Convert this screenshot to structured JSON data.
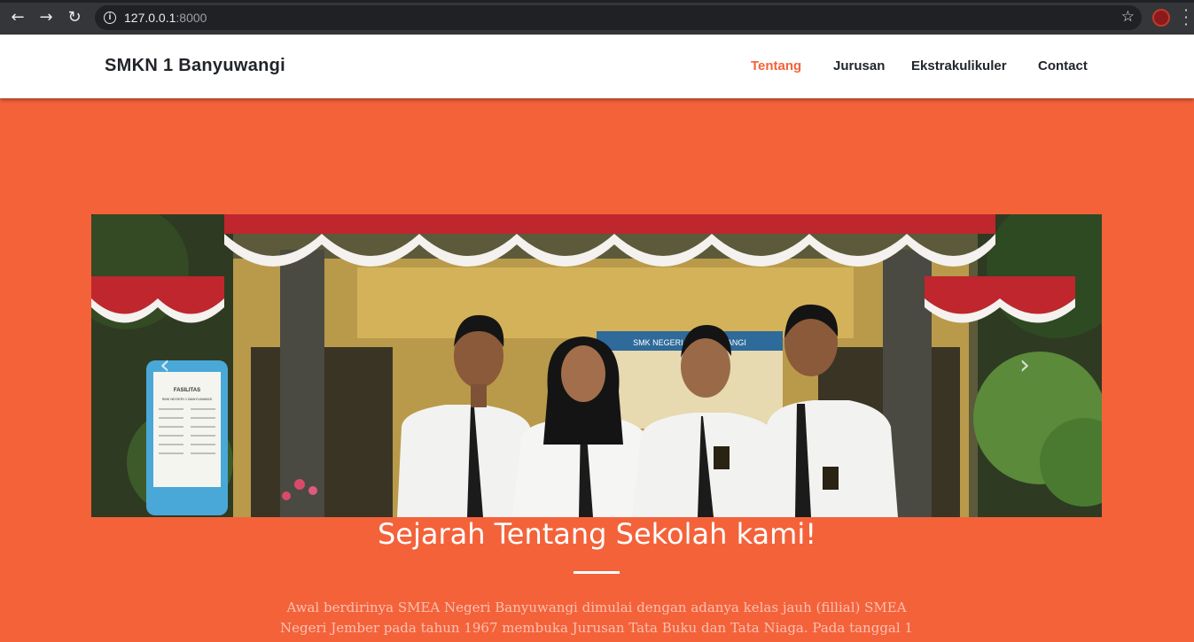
{
  "browser": {
    "url_host": "127.0.0.1",
    "url_port": ":8000"
  },
  "navbar": {
    "brand": "SMKN 1 Banyuwangi",
    "links": [
      {
        "label": "Tentang",
        "active": true
      },
      {
        "label": "Jurusan",
        "active": false
      },
      {
        "label": "Ekstrakulikuler",
        "active": false
      },
      {
        "label": "Contact",
        "active": false
      }
    ]
  },
  "hero": {
    "heading": "Sejarah Tentang Sekolah kami!",
    "paragraph": "Awal berdirinya SMEA Negeri Banyuwangi dimulai dengan adanya kelas jauh (fillial) SMEA Negeri Jember pada tahun 1967 membuka Jurusan Tata Buku dan Tata Niaga. Pada tanggal 1",
    "image_signs": {
      "board_title": "FASILITAS",
      "board_subtitle": "SMK NEGERI 1 BANYUWANGI",
      "banner_text": "SMK NEGERI 1 BANYUWANGI"
    }
  },
  "colors": {
    "primary": "#f4623a",
    "navbar_bg": "#ffffff",
    "text_dark": "#212529"
  }
}
